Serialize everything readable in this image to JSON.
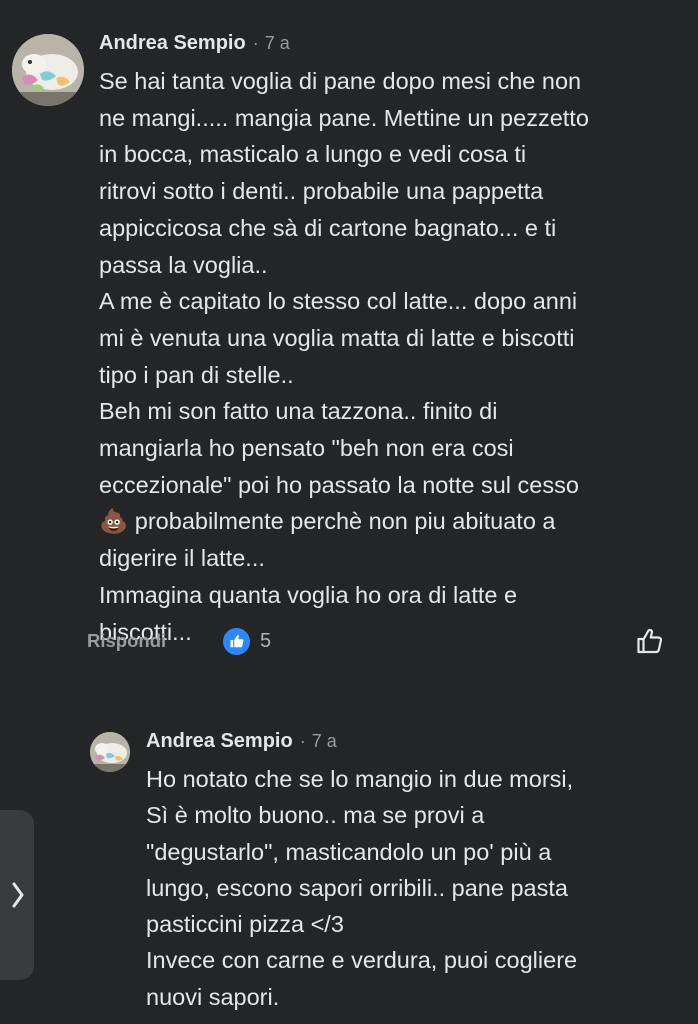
{
  "comment": {
    "author": "Andrea Sempio",
    "separator": "·",
    "time": "7 a",
    "text": "Se hai tanta voglia di pane dopo mesi che non\nne mangi..... mangia pane. Mettine un pezzetto\nin bocca, masticalo a lungo e vedi cosa ti\nritrovi sotto i denti.. probabile una pappetta\nappiccicosa che sà di cartone bagnato... e ti\npassa la voglia..\nA me è capitato lo stesso col latte... dopo anni\nmi è venuta una voglia matta di latte e biscotti\ntipo i pan di stelle..\nBeh mi son fatto una tazzona.. finito di\nmangiarla ho pensato \"beh non era cosi\neccezionale\" poi ho passato la notte sul cesso\n💩 probabilmente perchè non piu abituato a\ndigerire il latte...\nImmagina quanta voglia ho ora di latte e\nbiscotti...",
    "actions": {
      "reply_label": "Rispondi",
      "like_count": "5",
      "reaction_icon": "thumbs-up-icon",
      "like_button_icon": "thumbs-up-outline-icon"
    }
  },
  "reply": {
    "author": "Andrea Sempio",
    "separator": "·",
    "time": "7 a",
    "text": "Ho notato che se lo mangio in due morsi,\nSì è molto buono.. ma se provi a\n\"degustarlo\", masticandolo un po' più a\nlungo, escono sapori orribili.. pane pasta\npasticcini pizza </3\nInvece con carne e verdura, puoi cogliere\nnuovi sapori."
  },
  "side_tab": {
    "icon": "chevron-right-icon"
  },
  "colors": {
    "background": "#242526",
    "text": "#e4e6eb",
    "secondary_text": "#9a9ca0",
    "like_blue": "#2d88ff",
    "side_tab": "#3a3b3c"
  }
}
